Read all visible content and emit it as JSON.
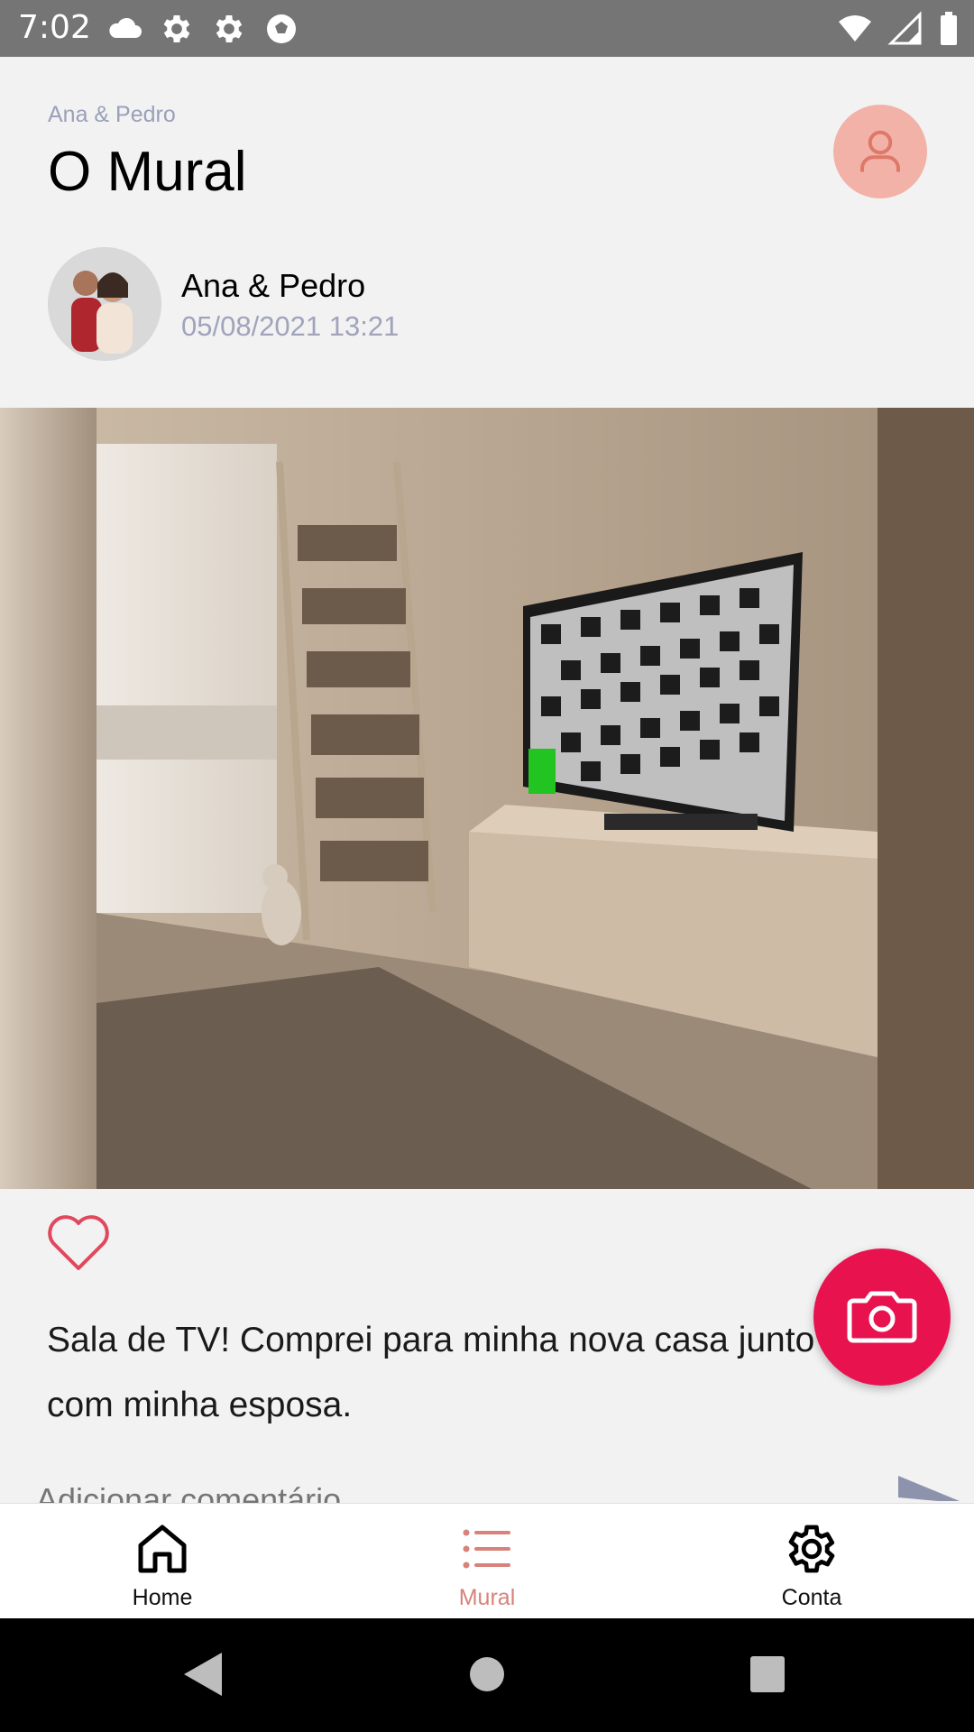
{
  "status_bar": {
    "time": "7:02",
    "left_icons": [
      "cloud-icon",
      "gear-icon",
      "gear-icon",
      "soccer-ball-icon"
    ],
    "right_icons": [
      "wifi-icon",
      "signal-icon",
      "battery-icon"
    ]
  },
  "header": {
    "subtitle": "Ana & Pedro",
    "title": "O Mural",
    "profile_icon": "user-icon"
  },
  "post": {
    "author_name": "Ana & Pedro",
    "date": "05/08/2021 13:21",
    "image_desc_icon": "photo",
    "like_icon": "heart-outline-icon",
    "caption": "Sala de TV! Comprei para minha nova casa junto com minha esposa.",
    "comment_placeholder": "Adicionar comentário",
    "send_icon": "send-icon"
  },
  "fab": {
    "icon": "camera-icon"
  },
  "bottom_nav": {
    "items": [
      {
        "label": "Home",
        "icon": "home-icon",
        "active": false
      },
      {
        "label": "Mural",
        "icon": "list-icon",
        "active": true
      },
      {
        "label": "Conta",
        "icon": "gear-icon",
        "active": false
      }
    ]
  },
  "colors": {
    "accent": "#e8124f",
    "profile_bg": "#f2b2a8",
    "active_nav": "#d7827a",
    "muted_text": "#a0a4bb"
  }
}
